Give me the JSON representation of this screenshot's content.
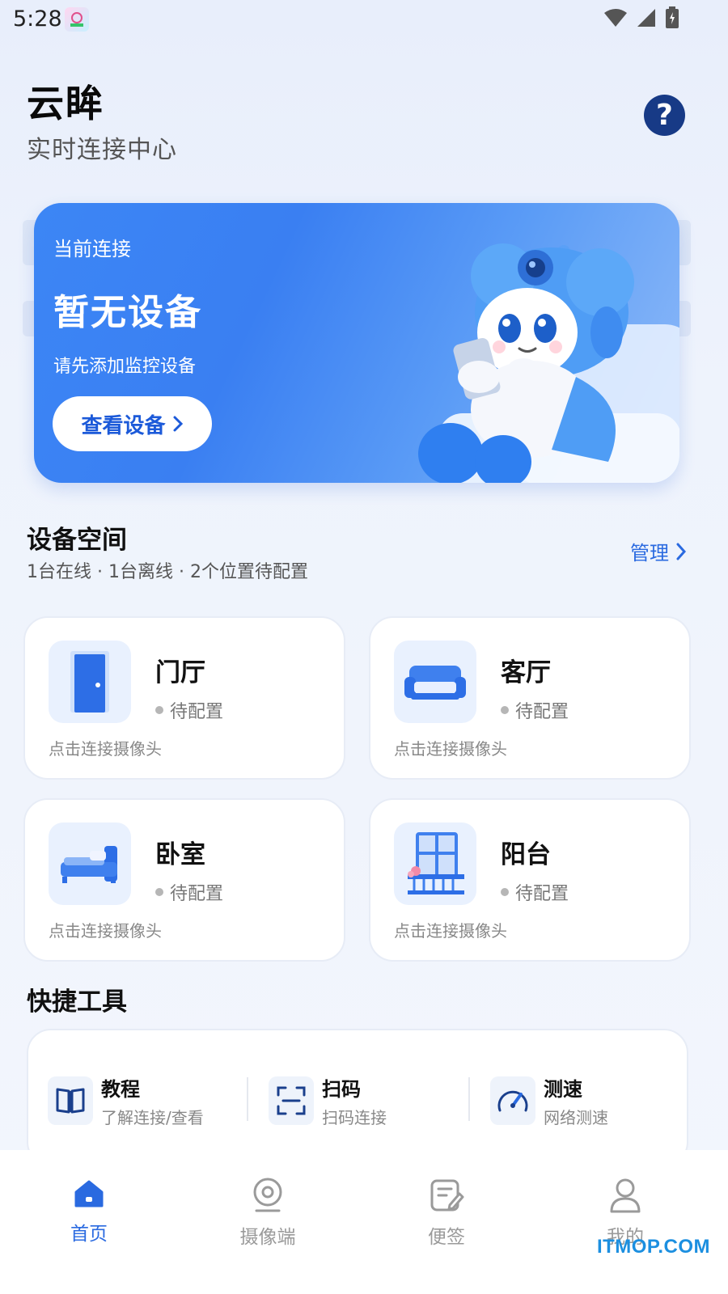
{
  "status_bar": {
    "time": "5:28"
  },
  "header": {
    "title": "云眸",
    "subtitle": "实时连接中心",
    "help_icon": "?"
  },
  "hero": {
    "label": "当前连接",
    "title": "暂无设备",
    "description": "请先添加监控设备",
    "button_label": "查看设备"
  },
  "devices": {
    "section_title": "设备空间",
    "summary": "1台在线 · 1台离线 · 2个位置待配置",
    "manage_label": "管理",
    "items": [
      {
        "name": "门厅",
        "status": "待配置",
        "hint": "点击连接摄像头",
        "icon": "door-icon"
      },
      {
        "name": "客厅",
        "status": "待配置",
        "hint": "点击连接摄像头",
        "icon": "sofa-icon"
      },
      {
        "name": "卧室",
        "status": "待配置",
        "hint": "点击连接摄像头",
        "icon": "bed-icon"
      },
      {
        "name": "阳台",
        "status": "待配置",
        "hint": "点击连接摄像头",
        "icon": "balcony-icon"
      }
    ]
  },
  "tools": {
    "section_title": "快捷工具",
    "items": [
      {
        "name": "教程",
        "desc": "了解连接/查看",
        "icon": "book-icon"
      },
      {
        "name": "扫码",
        "desc": "扫码连接",
        "icon": "scan-icon"
      },
      {
        "name": "测速",
        "desc": "网络测速",
        "icon": "speedometer-icon"
      }
    ]
  },
  "bottom_nav": {
    "items": [
      {
        "label": "首页",
        "icon": "home-icon",
        "active": true
      },
      {
        "label": "摄像端",
        "icon": "camera-icon",
        "active": false
      },
      {
        "label": "便签",
        "icon": "note-icon",
        "active": false
      },
      {
        "label": "我的",
        "icon": "profile-icon",
        "active": false
      }
    ]
  },
  "colors": {
    "accent": "#2a6ae0",
    "hero_blue": "#3c86f5",
    "help_bg": "#173a86"
  },
  "watermark": "ITMOP.COM"
}
